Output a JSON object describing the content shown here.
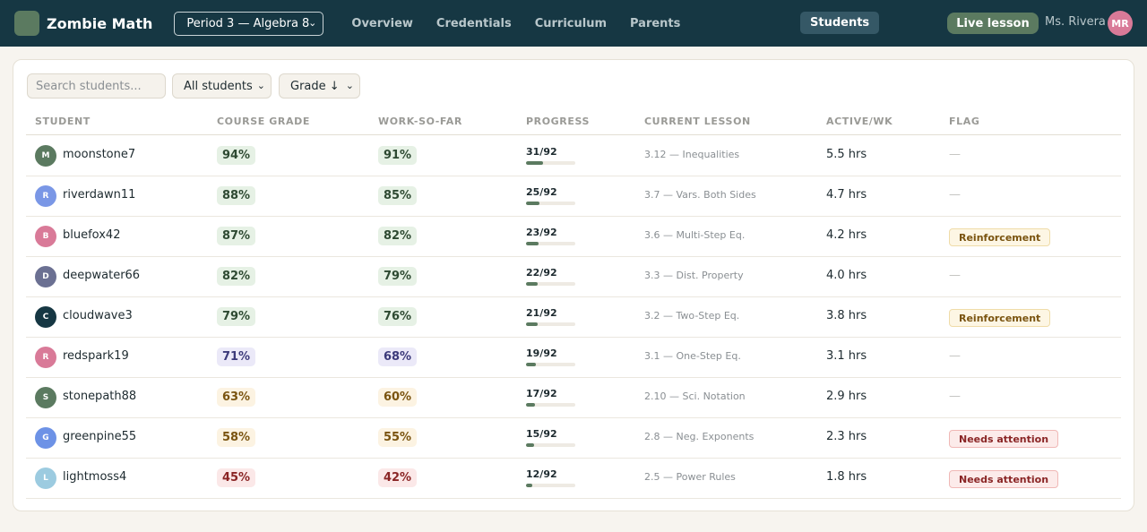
{
  "app": {
    "title": "Zombie Math",
    "class_select": "Period 3 — Algebra 8"
  },
  "nav": [
    {
      "label": "Overview",
      "active": false
    },
    {
      "label": "Students",
      "active": true
    },
    {
      "label": "Credentials",
      "active": false
    },
    {
      "label": "Curriculum",
      "active": false
    },
    {
      "label": "Parents",
      "active": false
    }
  ],
  "header": {
    "live_button": "Live lesson",
    "teacher_name": "Ms. Rivera",
    "teacher_initials": "MR"
  },
  "toolbar": {
    "search_placeholder": "Search students...",
    "filter_value": "All students",
    "sort_value": "Grade ↓"
  },
  "columns": [
    "STUDENT",
    "COURSE GRADE",
    "WORK-SO-FAR",
    "PROGRESS",
    "CURRENT LESSON",
    "ACTIVE/WK",
    "FLAG"
  ],
  "colors": {
    "topbar": "#163743",
    "accent": "#5b7a60"
  },
  "students": [
    {
      "initial": "M",
      "avatar_color": "#5b7a60",
      "name": "moonstone7",
      "grade": "94%",
      "grade_tone": "green",
      "work": "91%",
      "work_tone": "green",
      "progress": "31/92",
      "progress_frac": 0.337,
      "lesson": "3.12 — Inequalities",
      "active": "5.5 hrs",
      "flag": "—",
      "flag_type": "none"
    },
    {
      "initial": "R",
      "avatar_color": "#7a97e6",
      "name": "riverdawn11",
      "grade": "88%",
      "grade_tone": "green",
      "work": "85%",
      "work_tone": "green",
      "progress": "25/92",
      "progress_frac": 0.272,
      "lesson": "3.7 — Vars. Both Sides",
      "active": "4.7 hrs",
      "flag": "—",
      "flag_type": "none"
    },
    {
      "initial": "B",
      "avatar_color": "#d97a98",
      "name": "bluefox42",
      "grade": "87%",
      "grade_tone": "green",
      "work": "82%",
      "work_tone": "green",
      "progress": "23/92",
      "progress_frac": 0.25,
      "lesson": "3.6 — Multi-Step Eq.",
      "active": "4.2 hrs",
      "flag": "Reinforcement",
      "flag_type": "reinf"
    },
    {
      "initial": "D",
      "avatar_color": "#6b7092",
      "name": "deepwater66",
      "grade": "82%",
      "grade_tone": "green",
      "work": "79%",
      "work_tone": "green",
      "progress": "22/92",
      "progress_frac": 0.239,
      "lesson": "3.3 — Dist. Property",
      "active": "4.0 hrs",
      "flag": "—",
      "flag_type": "none"
    },
    {
      "initial": "C",
      "avatar_color": "#163743",
      "name": "cloudwave3",
      "grade": "79%",
      "grade_tone": "green",
      "work": "76%",
      "work_tone": "green",
      "progress": "21/92",
      "progress_frac": 0.228,
      "lesson": "3.2 — Two-Step Eq.",
      "active": "3.8 hrs",
      "flag": "Reinforcement",
      "flag_type": "reinf"
    },
    {
      "initial": "R",
      "avatar_color": "#d97a98",
      "name": "redspark19",
      "grade": "71%",
      "grade_tone": "blue",
      "work": "68%",
      "work_tone": "blue",
      "progress": "19/92",
      "progress_frac": 0.207,
      "lesson": "3.1 — One-Step Eq.",
      "active": "3.1 hrs",
      "flag": "—",
      "flag_type": "none"
    },
    {
      "initial": "S",
      "avatar_color": "#5b7a60",
      "name": "stonepath88",
      "grade": "63%",
      "grade_tone": "amber",
      "work": "60%",
      "work_tone": "amber",
      "progress": "17/92",
      "progress_frac": 0.185,
      "lesson": "2.10 — Sci. Notation",
      "active": "2.9 hrs",
      "flag": "—",
      "flag_type": "none"
    },
    {
      "initial": "G",
      "avatar_color": "#6d92e6",
      "name": "greenpine55",
      "grade": "58%",
      "grade_tone": "amber",
      "work": "55%",
      "work_tone": "amber",
      "progress": "15/92",
      "progress_frac": 0.163,
      "lesson": "2.8 — Neg. Exponents",
      "active": "2.3 hrs",
      "flag": "Needs attention",
      "flag_type": "attn"
    },
    {
      "initial": "L",
      "avatar_color": "#9ccbe0",
      "name": "lightmoss4",
      "grade": "45%",
      "grade_tone": "red",
      "work": "42%",
      "work_tone": "red",
      "progress": "12/92",
      "progress_frac": 0.13,
      "lesson": "2.5 — Power Rules",
      "active": "1.8 hrs",
      "flag": "Needs attention",
      "flag_type": "attn"
    }
  ]
}
